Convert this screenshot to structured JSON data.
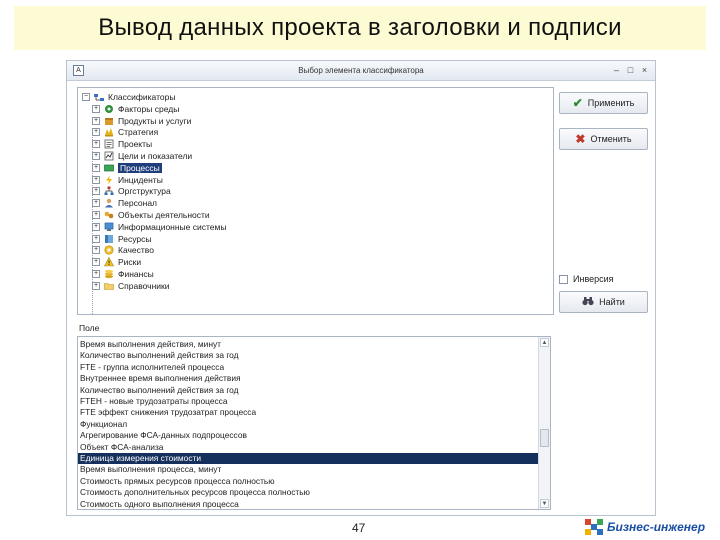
{
  "slide": {
    "title": "Вывод данных проекта в заголовки и подписи",
    "page_number": "47",
    "brand": "Бизнес-инженер"
  },
  "dialog": {
    "title": "Выбор элемента классификатора",
    "window_controls": [
      "–",
      "□",
      "×"
    ],
    "apply_label": "Применить",
    "cancel_label": "Отменить",
    "inversion_label": "Инверсия",
    "find_label": "Найти",
    "field_label": "Поле"
  },
  "tree": {
    "root": "Классификаторы",
    "items": [
      {
        "label": "Факторы среды",
        "icon": "factors-icon"
      },
      {
        "label": "Продукты и услуги",
        "icon": "products-icon"
      },
      {
        "label": "Стратегия",
        "icon": "strategy-icon"
      },
      {
        "label": "Проекты",
        "icon": "projects-icon"
      },
      {
        "label": "Цели и показатели",
        "icon": "goals-icon"
      },
      {
        "label": "Процессы",
        "icon": "processes-icon",
        "selected": true
      },
      {
        "label": "Инциденты",
        "icon": "incidents-icon"
      },
      {
        "label": "Оргструктура",
        "icon": "orgstructure-icon"
      },
      {
        "label": "Персонал",
        "icon": "personnel-icon"
      },
      {
        "label": "Объекты деятельности",
        "icon": "objects-icon"
      },
      {
        "label": "Информационные системы",
        "icon": "info-systems-icon"
      },
      {
        "label": "Ресурсы",
        "icon": "resources-icon"
      },
      {
        "label": "Качество",
        "icon": "quality-icon"
      },
      {
        "label": "Риски",
        "icon": "risks-icon"
      },
      {
        "label": "Финансы",
        "icon": "finance-icon"
      },
      {
        "label": "Справочники",
        "icon": "folder-icon"
      }
    ]
  },
  "fields": {
    "items": [
      "Время выполнения действия, минут",
      "Количество выполнений действия за год",
      "FTE - группа исполнителей процесса",
      "Внутреннее время выполнения действия",
      "Количество выполнений действия за год",
      "FTEH - новые трудозатраты процесса",
      "FTE эффект снижения трудозатрат процесса",
      "Функционал",
      "Агрегирование ФСА-данных подпроцессов",
      "Объект ФСА-анализа",
      "Единица измерения стоимости",
      "Время выполнения процесса, минут",
      "Стоимость прямых ресурсов процесса полностью",
      "Стоимость дополнительных ресурсов процесса полностью",
      "Стоимость одного выполнения процесса"
    ],
    "selected_index": 10
  },
  "colors": {
    "selection": "#16305e",
    "title_band": "#fdfbd3",
    "brand": "#1a4fa3"
  }
}
